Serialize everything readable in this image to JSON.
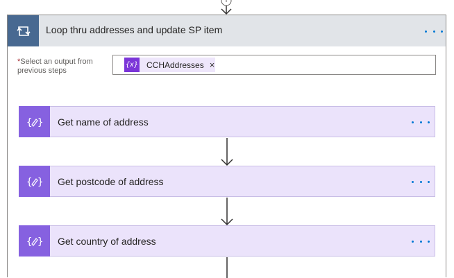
{
  "loop": {
    "title": "Loop thru addresses and update SP item",
    "icon": "loop-icon",
    "header_color": "#e1e4e8",
    "icon_color": "#486991"
  },
  "select_field": {
    "required_mark": "*",
    "label": "Select an output from previous steps",
    "token": {
      "icon": "expression-variable-icon",
      "icon_text": "{x}",
      "label": "CCHAddresses",
      "remove": "×"
    }
  },
  "actions": [
    {
      "title": "Get name of address",
      "icon": "compose-icon"
    },
    {
      "title": "Get postcode of address",
      "icon": "compose-icon"
    },
    {
      "title": "Get country of address",
      "icon": "compose-icon"
    }
  ],
  "colors": {
    "action_bg": "#ebe3fb",
    "action_icon": "#8661e0",
    "token_icon": "#7b35d8",
    "accent": "#0078d4"
  }
}
